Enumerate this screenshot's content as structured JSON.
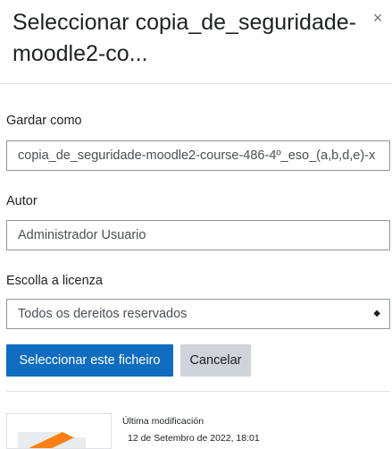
{
  "dialog": {
    "title": "Seleccionar copia_de_seguridade-moodle2-co...",
    "close_glyph": "×"
  },
  "form": {
    "save_as": {
      "label": "Gardar como",
      "value": "copia_de_seguridade-moodle2-course-486-4º_eso_(a,b,d,e)-x"
    },
    "author": {
      "label": "Autor",
      "value": "Administrador Usuario"
    },
    "license": {
      "label": "Escolla a licenza",
      "selected": "Todos os dereitos reservados",
      "arrow_glyph": "◆"
    }
  },
  "buttons": {
    "select_label": "Seleccionar este ficheiro",
    "cancel_label": "Cancelar"
  },
  "file_info": {
    "last_modified_label": "Última modificación",
    "last_modified_value": "12 de Setembro de 2022, 18:01"
  },
  "colors": {
    "primary": "#0f6cbf",
    "secondary": "#ced4da",
    "thumbnail_accent": "#f98012"
  },
  "icons": {
    "close": "close-icon",
    "select_arrow": "select-arrow-icon",
    "thumbnail": "moodle-backup-file-icon"
  }
}
